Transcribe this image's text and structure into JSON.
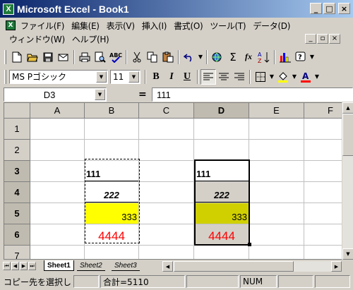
{
  "window": {
    "title": "Microsoft Excel - Book1",
    "app_icon": "X",
    "doc_icon": "X"
  },
  "menu": {
    "row1": [
      "ファイル(F)",
      "編集(E)",
      "表示(V)",
      "挿入(I)",
      "書式(O)",
      "ツール(T)",
      "データ(D)"
    ],
    "row2": [
      "ウィンドウ(W)",
      "ヘルプ(H)"
    ]
  },
  "format": {
    "font_name": "MS Pゴシック",
    "font_size": "11"
  },
  "formula_bar": {
    "name_box": "D3",
    "equals": "=",
    "content": "111"
  },
  "columns": [
    "A",
    "B",
    "C",
    "D",
    "E",
    "F"
  ],
  "rows": [
    "1",
    "2",
    "3",
    "4",
    "5",
    "6",
    "7"
  ],
  "cells": {
    "B3": "111",
    "B4": "222",
    "B5": "333",
    "B6": "4444",
    "D3": "111",
    "D4": "222",
    "D5": "333",
    "D6": "4444"
  },
  "colors": {
    "yellow_fill": "#ffff00",
    "olive_fill": "#d0d000",
    "gray_fill": "#d4d0c8",
    "red_text": "#ff0000"
  },
  "tabs": [
    "Sheet1",
    "Sheet2",
    "Sheet3"
  ],
  "status": {
    "message": "コピー先を選択し",
    "sum": "合計=5110",
    "num": "NUM"
  },
  "icons": [
    "new-icon",
    "open-icon",
    "save-icon",
    "mail-icon",
    "print-icon",
    "print-preview-icon",
    "spelling-icon",
    "cut-icon",
    "copy-icon",
    "paste-icon",
    "undo-icon",
    "hyperlink-icon",
    "autosum-icon",
    "function-icon",
    "sort-ascending-icon",
    "chart-wizard-icon",
    "help-icon",
    "bold-icon",
    "italic-icon",
    "underline-icon",
    "align-left-icon",
    "align-center-icon",
    "align-right-icon",
    "borders-icon",
    "fill-color-icon",
    "font-color-icon"
  ]
}
